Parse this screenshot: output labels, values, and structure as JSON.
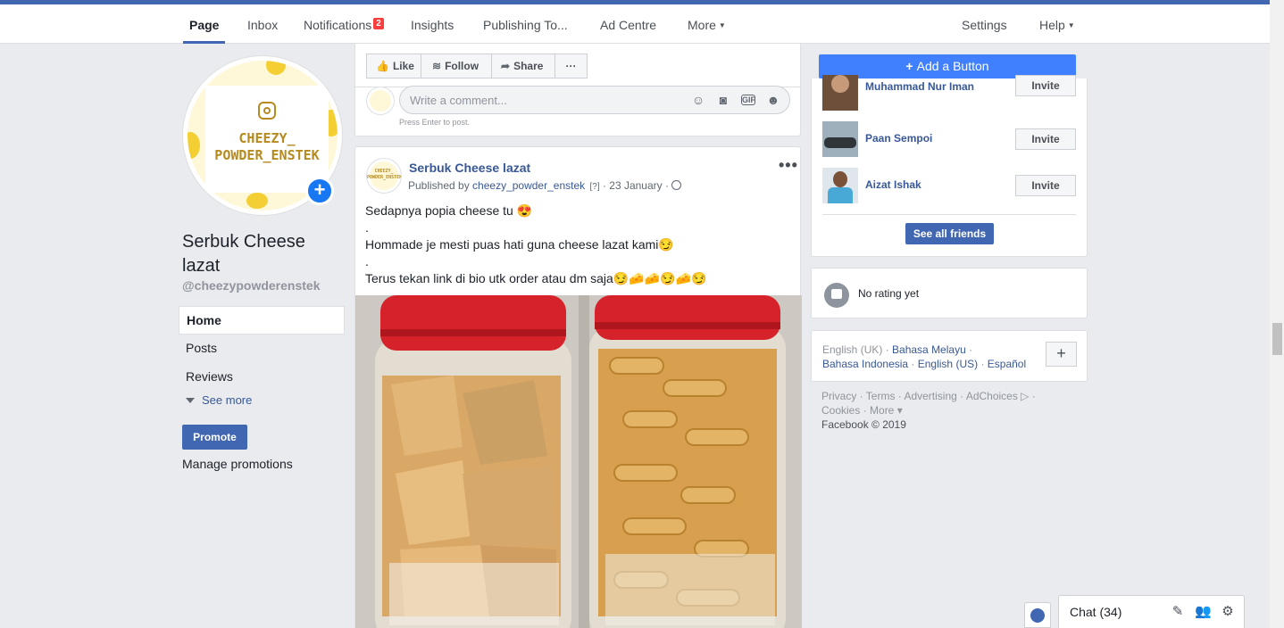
{
  "nav": {
    "tabs": [
      {
        "label": "Page"
      },
      {
        "label": "Inbox"
      },
      {
        "label": "Notifications",
        "badge": "2"
      },
      {
        "label": "Insights"
      },
      {
        "label": "Publishing To..."
      },
      {
        "label": "Ad Centre"
      },
      {
        "label": "More"
      }
    ],
    "right": [
      {
        "label": "Settings"
      },
      {
        "label": "Help"
      }
    ],
    "accent_color": "#4267b2"
  },
  "page": {
    "avatar_text": "CHEEZY_ POWDER_ENSTEK",
    "name": "Serbuk Cheese lazat",
    "handle": "@cheezypowderenstek"
  },
  "left_nav": {
    "items": [
      {
        "label": "Home"
      },
      {
        "label": "Posts"
      },
      {
        "label": "Reviews"
      }
    ],
    "see_more": "See more",
    "promote": "Promote",
    "manage_promotions": "Manage promotions"
  },
  "actions": {
    "like": "Like",
    "follow": "Follow",
    "share": "Share",
    "more": "···",
    "add_button": "Add a Button",
    "comment_placeholder": "Write a comment...",
    "enter_hint": "Press Enter to post."
  },
  "post": {
    "author": "Serbuk Cheese lazat",
    "published_by_prefix": "Published by ",
    "published_by": "cheezy_powder_enstek",
    "help": "[?]",
    "date": "23 January",
    "lines": [
      "Sedapnya popia cheese tu 😍",
      ".",
      "Hommade je mesti puas hati guna cheese lazat kami😏",
      ".",
      "Terus tekan link di bio utk order atau dm saja😏🧀🧀😏🧀😏"
    ]
  },
  "friends": {
    "items": [
      {
        "name": "Muhammad Nur Iman",
        "action": "Invite"
      },
      {
        "name": "Paan Sempoi",
        "action": "Invite"
      },
      {
        "name": "Aizat Ishak",
        "action": "Invite"
      }
    ],
    "see_all": "See all friends"
  },
  "rating": {
    "text": "No rating yet"
  },
  "languages": {
    "current": "English (UK)",
    "others_line1": [
      "Bahasa Melayu"
    ],
    "others_line2": [
      "Bahasa Indonesia",
      "English (US)",
      "Español"
    ]
  },
  "footer": {
    "line1": "Privacy · Terms · Advertising · AdChoices ▷ ·",
    "line2": "Cookies · More ▾",
    "copyright": "Facebook © 2019"
  },
  "chat": {
    "label": "Chat (34)"
  }
}
